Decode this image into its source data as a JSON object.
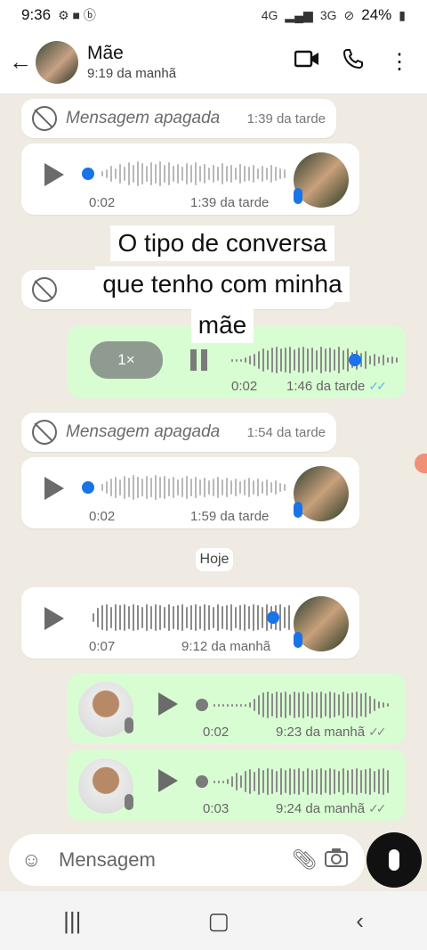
{
  "status": {
    "time": "9:36",
    "battery": "24%",
    "net1": "4G",
    "net2": "3G"
  },
  "header": {
    "title": "Mãe",
    "subtitle": "9:19 da manhã"
  },
  "messages": {
    "m1": {
      "text": "Mensagem apagada",
      "time": "1:39 da tarde"
    },
    "m2": {
      "duration": "0:02",
      "time": "1:39 da tarde"
    },
    "m4": {
      "speed": "1×",
      "duration": "0:02",
      "time": "1:46 da tarde"
    },
    "m5": {
      "text": "Mensagem apagada",
      "time": "1:54 da tarde"
    },
    "m6": {
      "duration": "0:02",
      "time": "1:59 da tarde"
    },
    "m7": {
      "duration": "0:07",
      "time": "9:12 da manhã"
    },
    "m8": {
      "duration": "0:02",
      "time": "9:23 da manhã"
    },
    "m9": {
      "duration": "0:03",
      "time": "9:24 da manhã"
    }
  },
  "date_chip": "Hoje",
  "overlay": {
    "line1": "O tipo de conversa",
    "line2": "que tenho com minha",
    "line3": "mãe"
  },
  "composer": {
    "placeholder": "Mensagem"
  },
  "colors": {
    "outgoing": "#d9fdd3",
    "incoming": "#ffffff",
    "read_ticks": "#53bdeb",
    "play_dot": "#1a73e8"
  }
}
